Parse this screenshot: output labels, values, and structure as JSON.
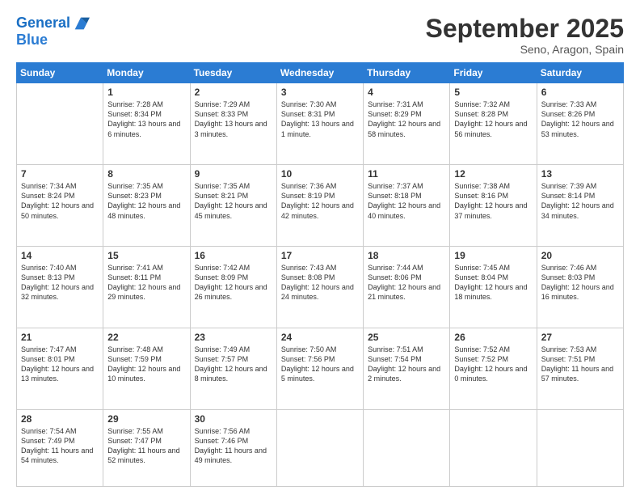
{
  "header": {
    "logo_line1": "General",
    "logo_line2": "Blue",
    "month": "September 2025",
    "location": "Seno, Aragon, Spain"
  },
  "days_of_week": [
    "Sunday",
    "Monday",
    "Tuesday",
    "Wednesday",
    "Thursday",
    "Friday",
    "Saturday"
  ],
  "weeks": [
    [
      {
        "day": "",
        "sunrise": "",
        "sunset": "",
        "daylight": ""
      },
      {
        "day": "1",
        "sunrise": "Sunrise: 7:28 AM",
        "sunset": "Sunset: 8:34 PM",
        "daylight": "Daylight: 13 hours and 6 minutes."
      },
      {
        "day": "2",
        "sunrise": "Sunrise: 7:29 AM",
        "sunset": "Sunset: 8:33 PM",
        "daylight": "Daylight: 13 hours and 3 minutes."
      },
      {
        "day": "3",
        "sunrise": "Sunrise: 7:30 AM",
        "sunset": "Sunset: 8:31 PM",
        "daylight": "Daylight: 13 hours and 1 minute."
      },
      {
        "day": "4",
        "sunrise": "Sunrise: 7:31 AM",
        "sunset": "Sunset: 8:29 PM",
        "daylight": "Daylight: 12 hours and 58 minutes."
      },
      {
        "day": "5",
        "sunrise": "Sunrise: 7:32 AM",
        "sunset": "Sunset: 8:28 PM",
        "daylight": "Daylight: 12 hours and 56 minutes."
      },
      {
        "day": "6",
        "sunrise": "Sunrise: 7:33 AM",
        "sunset": "Sunset: 8:26 PM",
        "daylight": "Daylight: 12 hours and 53 minutes."
      }
    ],
    [
      {
        "day": "7",
        "sunrise": "Sunrise: 7:34 AM",
        "sunset": "Sunset: 8:24 PM",
        "daylight": "Daylight: 12 hours and 50 minutes."
      },
      {
        "day": "8",
        "sunrise": "Sunrise: 7:35 AM",
        "sunset": "Sunset: 8:23 PM",
        "daylight": "Daylight: 12 hours and 48 minutes."
      },
      {
        "day": "9",
        "sunrise": "Sunrise: 7:35 AM",
        "sunset": "Sunset: 8:21 PM",
        "daylight": "Daylight: 12 hours and 45 minutes."
      },
      {
        "day": "10",
        "sunrise": "Sunrise: 7:36 AM",
        "sunset": "Sunset: 8:19 PM",
        "daylight": "Daylight: 12 hours and 42 minutes."
      },
      {
        "day": "11",
        "sunrise": "Sunrise: 7:37 AM",
        "sunset": "Sunset: 8:18 PM",
        "daylight": "Daylight: 12 hours and 40 minutes."
      },
      {
        "day": "12",
        "sunrise": "Sunrise: 7:38 AM",
        "sunset": "Sunset: 8:16 PM",
        "daylight": "Daylight: 12 hours and 37 minutes."
      },
      {
        "day": "13",
        "sunrise": "Sunrise: 7:39 AM",
        "sunset": "Sunset: 8:14 PM",
        "daylight": "Daylight: 12 hours and 34 minutes."
      }
    ],
    [
      {
        "day": "14",
        "sunrise": "Sunrise: 7:40 AM",
        "sunset": "Sunset: 8:13 PM",
        "daylight": "Daylight: 12 hours and 32 minutes."
      },
      {
        "day": "15",
        "sunrise": "Sunrise: 7:41 AM",
        "sunset": "Sunset: 8:11 PM",
        "daylight": "Daylight: 12 hours and 29 minutes."
      },
      {
        "day": "16",
        "sunrise": "Sunrise: 7:42 AM",
        "sunset": "Sunset: 8:09 PM",
        "daylight": "Daylight: 12 hours and 26 minutes."
      },
      {
        "day": "17",
        "sunrise": "Sunrise: 7:43 AM",
        "sunset": "Sunset: 8:08 PM",
        "daylight": "Daylight: 12 hours and 24 minutes."
      },
      {
        "day": "18",
        "sunrise": "Sunrise: 7:44 AM",
        "sunset": "Sunset: 8:06 PM",
        "daylight": "Daylight: 12 hours and 21 minutes."
      },
      {
        "day": "19",
        "sunrise": "Sunrise: 7:45 AM",
        "sunset": "Sunset: 8:04 PM",
        "daylight": "Daylight: 12 hours and 18 minutes."
      },
      {
        "day": "20",
        "sunrise": "Sunrise: 7:46 AM",
        "sunset": "Sunset: 8:03 PM",
        "daylight": "Daylight: 12 hours and 16 minutes."
      }
    ],
    [
      {
        "day": "21",
        "sunrise": "Sunrise: 7:47 AM",
        "sunset": "Sunset: 8:01 PM",
        "daylight": "Daylight: 12 hours and 13 minutes."
      },
      {
        "day": "22",
        "sunrise": "Sunrise: 7:48 AM",
        "sunset": "Sunset: 7:59 PM",
        "daylight": "Daylight: 12 hours and 10 minutes."
      },
      {
        "day": "23",
        "sunrise": "Sunrise: 7:49 AM",
        "sunset": "Sunset: 7:57 PM",
        "daylight": "Daylight: 12 hours and 8 minutes."
      },
      {
        "day": "24",
        "sunrise": "Sunrise: 7:50 AM",
        "sunset": "Sunset: 7:56 PM",
        "daylight": "Daylight: 12 hours and 5 minutes."
      },
      {
        "day": "25",
        "sunrise": "Sunrise: 7:51 AM",
        "sunset": "Sunset: 7:54 PM",
        "daylight": "Daylight: 12 hours and 2 minutes."
      },
      {
        "day": "26",
        "sunrise": "Sunrise: 7:52 AM",
        "sunset": "Sunset: 7:52 PM",
        "daylight": "Daylight: 12 hours and 0 minutes."
      },
      {
        "day": "27",
        "sunrise": "Sunrise: 7:53 AM",
        "sunset": "Sunset: 7:51 PM",
        "daylight": "Daylight: 11 hours and 57 minutes."
      }
    ],
    [
      {
        "day": "28",
        "sunrise": "Sunrise: 7:54 AM",
        "sunset": "Sunset: 7:49 PM",
        "daylight": "Daylight: 11 hours and 54 minutes."
      },
      {
        "day": "29",
        "sunrise": "Sunrise: 7:55 AM",
        "sunset": "Sunset: 7:47 PM",
        "daylight": "Daylight: 11 hours and 52 minutes."
      },
      {
        "day": "30",
        "sunrise": "Sunrise: 7:56 AM",
        "sunset": "Sunset: 7:46 PM",
        "daylight": "Daylight: 11 hours and 49 minutes."
      },
      {
        "day": "",
        "sunrise": "",
        "sunset": "",
        "daylight": ""
      },
      {
        "day": "",
        "sunrise": "",
        "sunset": "",
        "daylight": ""
      },
      {
        "day": "",
        "sunrise": "",
        "sunset": "",
        "daylight": ""
      },
      {
        "day": "",
        "sunrise": "",
        "sunset": "",
        "daylight": ""
      }
    ]
  ]
}
